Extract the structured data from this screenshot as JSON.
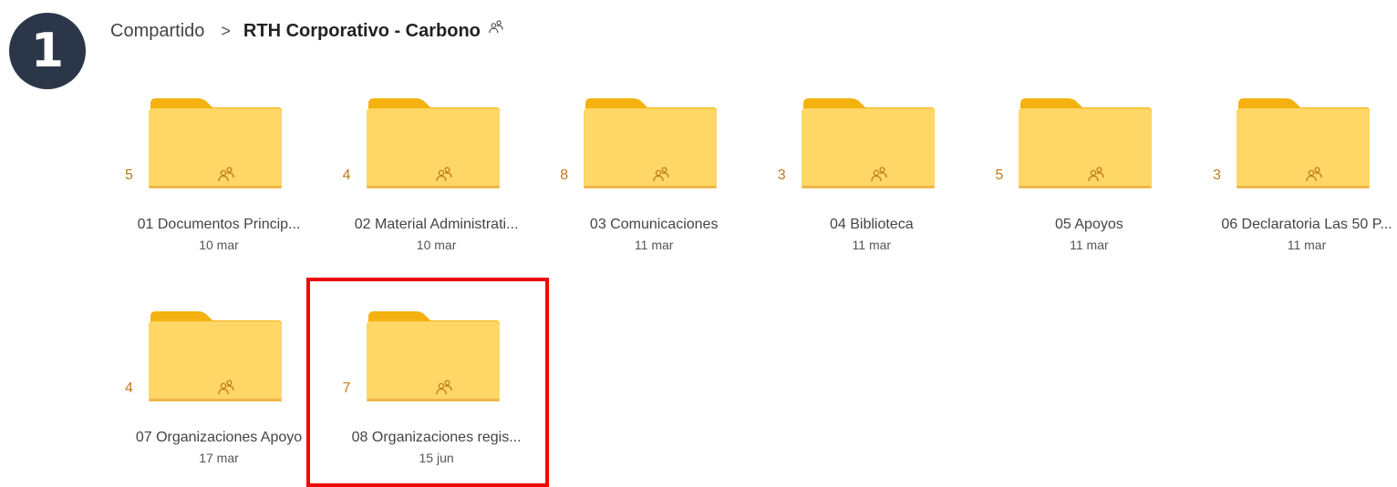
{
  "step": {
    "number": "1"
  },
  "breadcrumb": {
    "root": "Compartido",
    "separator": ">",
    "current": "RTH Corporativo - Carbono",
    "shared_icon": "people-icon"
  },
  "colors": {
    "folder_body": "#ffd766",
    "folder_back": "#f3b20f",
    "folder_count": "#c07a18",
    "highlight": "#ee0a0a",
    "badge": "#2b3648"
  },
  "folders": [
    {
      "count": "5",
      "name": "01 Documentos Princip...",
      "date": "10 mar",
      "icon": "people-icon"
    },
    {
      "count": "4",
      "name": "02 Material Administrati...",
      "date": "10 mar",
      "icon": "people-icon"
    },
    {
      "count": "8",
      "name": "03 Comunicaciones",
      "date": "11 mar",
      "icon": "people-icon"
    },
    {
      "count": "3",
      "name": "04 Biblioteca",
      "date": "11 mar",
      "icon": "people-icon"
    },
    {
      "count": "5",
      "name": "05 Apoyos",
      "date": "11 mar",
      "icon": "people-icon"
    },
    {
      "count": "3",
      "name": "06 Declaratoria Las 50 P...",
      "date": "11 mar",
      "icon": "people-icon"
    },
    {
      "count": "4",
      "name": "07 Organizaciones Apoyo",
      "date": "17 mar",
      "icon": "people-icon"
    },
    {
      "count": "7",
      "name": "08 Organizaciones regis...",
      "date": "15 jun",
      "icon": "people-icon",
      "highlighted": true
    }
  ]
}
